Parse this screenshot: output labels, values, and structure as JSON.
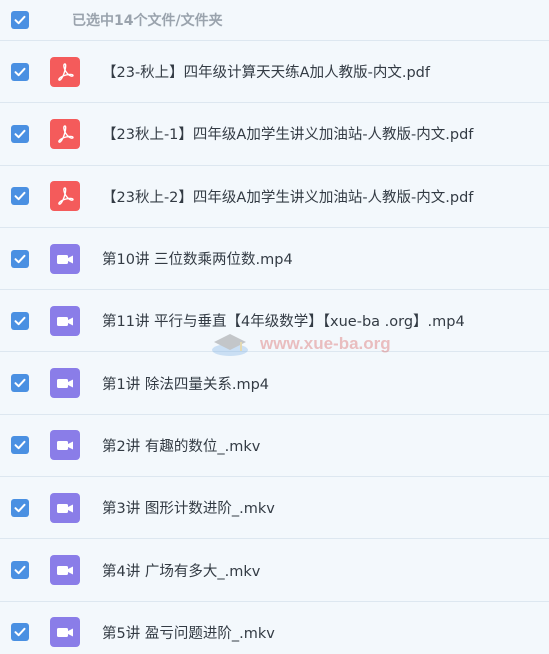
{
  "header": {
    "title": "已选中14个文件/文件夹"
  },
  "files": [
    {
      "name": "【23-秋上】四年级计算天天练A加人教版-内文.pdf",
      "type": "pdf"
    },
    {
      "name": "【23秋上-1】四年级A加学生讲义加油站-人教版-内文.pdf",
      "type": "pdf"
    },
    {
      "name": "【23秋上-2】四年级A加学生讲义加油站-人教版-内文.pdf",
      "type": "pdf"
    },
    {
      "name": "第10讲 三位数乘两位数.mp4",
      "type": "video"
    },
    {
      "name": "第11讲 平行与垂直【4年级数学】【xue-ba .org】.mp4",
      "type": "video"
    },
    {
      "name": "第1讲 除法四量关系.mp4",
      "type": "video"
    },
    {
      "name": "第2讲 有趣的数位_.mkv",
      "type": "video"
    },
    {
      "name": "第3讲 图形计数进阶_.mkv",
      "type": "video"
    },
    {
      "name": "第4讲 广场有多大_.mkv",
      "type": "video"
    },
    {
      "name": "第5讲 盈亏问题进阶_.mkv",
      "type": "video"
    }
  ],
  "watermark": {
    "text": "www.xue-ba.org"
  },
  "colors": {
    "checkbox": "#4a90e2",
    "pdf": "#f45b5b",
    "video": "#8a7de8"
  }
}
